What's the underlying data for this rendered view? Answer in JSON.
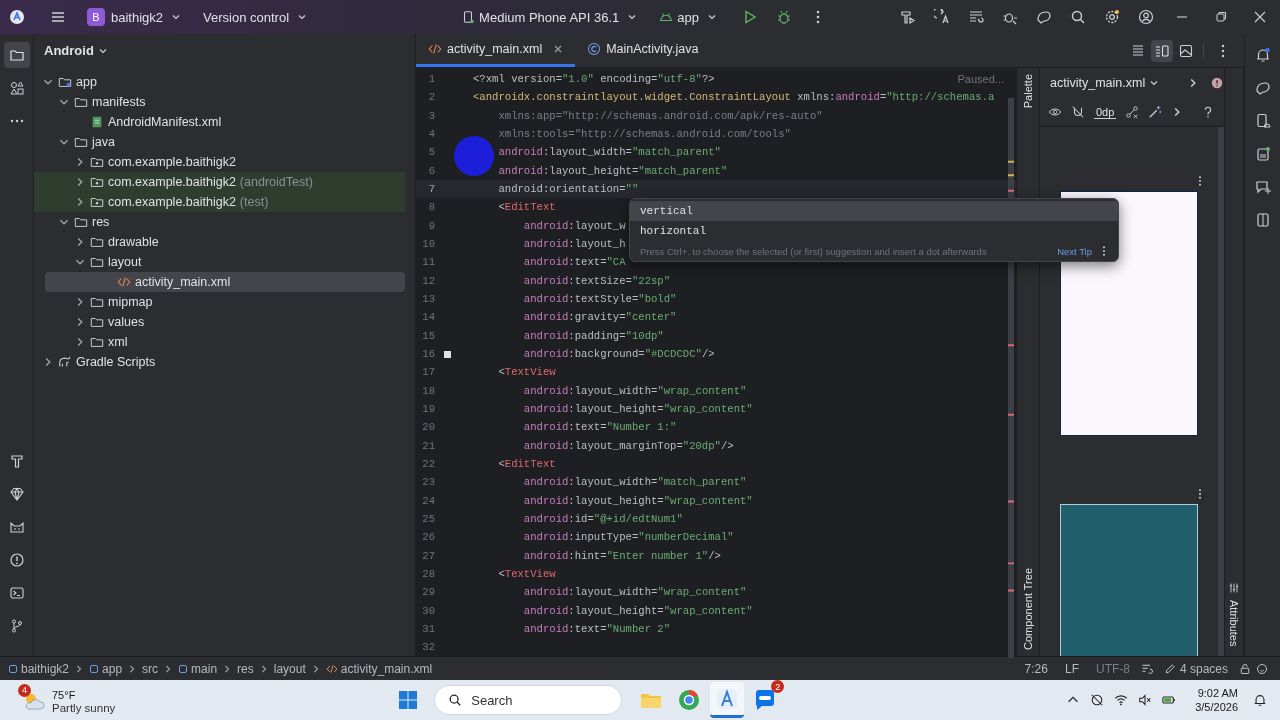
{
  "title_bar": {
    "project_initial": "B",
    "project": "baithigk2",
    "vcs": "Version control",
    "device": "Medium Phone API 36.1",
    "run_config": "app"
  },
  "project_panel": {
    "view": "Android",
    "tree": [
      {
        "label": "app",
        "kind": "module",
        "expanded": true,
        "selected": false,
        "children": [
          {
            "label": "manifests",
            "kind": "folder",
            "expanded": true,
            "selected": false,
            "children": [
              {
                "label": "AndroidManifest.xml",
                "kind": "manifest",
                "selected": false
              }
            ]
          },
          {
            "label": "java",
            "kind": "folder",
            "expanded": true,
            "selected": false,
            "children": [
              {
                "label": "com.example.baithigk2",
                "kind": "package",
                "expanded": false,
                "selected": false
              },
              {
                "label": "com.example.baithigk2",
                "note": "(androidTest)",
                "kind": "test-package",
                "expanded": false,
                "selected": false
              },
              {
                "label": "com.example.baithigk2",
                "note": "(test)",
                "kind": "test-package",
                "expanded": false,
                "selected": false
              }
            ]
          },
          {
            "label": "res",
            "kind": "folder",
            "expanded": true,
            "selected": false,
            "children": [
              {
                "label": "drawable",
                "kind": "folder",
                "expanded": false,
                "selected": false
              },
              {
                "label": "layout",
                "kind": "folder",
                "expanded": true,
                "selected": false,
                "children": [
                  {
                    "label": "activity_main.xml",
                    "kind": "xml",
                    "selected": true
                  }
                ]
              },
              {
                "label": "mipmap",
                "kind": "folder",
                "expanded": false,
                "selected": false
              },
              {
                "label": "values",
                "kind": "folder",
                "expanded": false,
                "selected": false
              },
              {
                "label": "xml",
                "kind": "folder",
                "expanded": false,
                "selected": false
              }
            ]
          }
        ]
      },
      {
        "label": "Gradle Scripts",
        "kind": "scripts",
        "expanded": false,
        "selected": false
      }
    ]
  },
  "editor_tabs": [
    {
      "label": "activity_main.xml",
      "kind": "xml",
      "selected": true,
      "closable": true
    },
    {
      "label": "MainActivity.java",
      "kind": "java",
      "selected": false,
      "closable": false
    }
  ],
  "editor": {
    "status": "Paused...",
    "lines": [
      {
        "number": "1",
        "current": false,
        "bookmark": false,
        "tokens": [
          {
            "kind": "plain",
            "text": "<?xml version="
          },
          {
            "kind": "string",
            "text": "\"1.0\""
          },
          {
            "kind": "plain",
            "text": " encoding="
          },
          {
            "kind": "string",
            "text": "\"utf-8\""
          },
          {
            "kind": "plain",
            "text": "?>"
          }
        ]
      },
      {
        "number": "2",
        "current": false,
        "bookmark": false,
        "tokens": [
          {
            "kind": "tag",
            "text": "<androidx.constraintlayout.widget.ConstraintLayout"
          },
          {
            "kind": "plain",
            "text": " xmlns:"
          },
          {
            "kind": "ns",
            "text": "android"
          },
          {
            "kind": "plain",
            "text": "="
          },
          {
            "kind": "string",
            "text": "\"http://schemas.a"
          }
        ]
      },
      {
        "number": "3",
        "current": false,
        "bookmark": false,
        "tokens": [
          {
            "kind": "dim",
            "text": "    xmlns:app=\"http://schemas.android.com/apk/res-auto\""
          }
        ]
      },
      {
        "number": "4",
        "current": false,
        "bookmark": false,
        "tokens": [
          {
            "kind": "dim",
            "text": "    xmlns:tools=\"http://schemas.android.com/tools\""
          }
        ]
      },
      {
        "number": "5",
        "current": false,
        "bookmark": false,
        "tokens": [
          {
            "kind": "ns",
            "text": "    android"
          },
          {
            "kind": "plain",
            "text": ":layout_width="
          },
          {
            "kind": "string",
            "text": "\"match_parent\""
          }
        ]
      },
      {
        "number": "6",
        "current": false,
        "bookmark": false,
        "tokens": [
          {
            "kind": "ns",
            "text": "    android"
          },
          {
            "kind": "plain",
            "text": ":layout_height="
          },
          {
            "kind": "string",
            "text": "\"match_parent\""
          }
        ]
      },
      {
        "number": "7",
        "current": true,
        "bookmark": false,
        "tokens": [
          {
            "kind": "plain",
            "text": "    android:orientation="
          },
          {
            "kind": "string",
            "text": "\"\""
          }
        ]
      },
      {
        "number": "8",
        "current": false,
        "bookmark": false,
        "tokens": [
          {
            "kind": "plain",
            "text": "    <"
          },
          {
            "kind": "error-tag",
            "text": "EditText"
          }
        ]
      },
      {
        "number": "9",
        "current": false,
        "bookmark": false,
        "tokens": [
          {
            "kind": "ns",
            "text": "        android"
          },
          {
            "kind": "plain",
            "text": ":layout_w"
          }
        ]
      },
      {
        "number": "10",
        "current": false,
        "bookmark": false,
        "tokens": [
          {
            "kind": "ns",
            "text": "        android"
          },
          {
            "kind": "plain",
            "text": ":layout_h"
          }
        ]
      },
      {
        "number": "11",
        "current": false,
        "bookmark": false,
        "tokens": [
          {
            "kind": "ns",
            "text": "        android"
          },
          {
            "kind": "plain",
            "text": ":text="
          },
          {
            "kind": "string",
            "text": "\"CA"
          }
        ]
      },
      {
        "number": "12",
        "current": false,
        "bookmark": false,
        "tokens": [
          {
            "kind": "ns",
            "text": "        android"
          },
          {
            "kind": "plain",
            "text": ":textSize="
          },
          {
            "kind": "string",
            "text": "\"22sp\""
          }
        ]
      },
      {
        "number": "13",
        "current": false,
        "bookmark": false,
        "tokens": [
          {
            "kind": "ns",
            "text": "        android"
          },
          {
            "kind": "plain",
            "text": ":textStyle="
          },
          {
            "kind": "string",
            "text": "\"bold\""
          }
        ]
      },
      {
        "number": "14",
        "current": false,
        "bookmark": false,
        "tokens": [
          {
            "kind": "ns",
            "text": "        android"
          },
          {
            "kind": "plain",
            "text": ":gravity="
          },
          {
            "kind": "string",
            "text": "\"center\""
          }
        ]
      },
      {
        "number": "15",
        "current": false,
        "bookmark": false,
        "tokens": [
          {
            "kind": "ns",
            "text": "        android"
          },
          {
            "kind": "plain",
            "text": ":padding="
          },
          {
            "kind": "string",
            "text": "\"10dp\""
          }
        ]
      },
      {
        "number": "16",
        "current": false,
        "bookmark": true,
        "tokens": [
          {
            "kind": "ns",
            "text": "        android"
          },
          {
            "kind": "plain",
            "text": ":background="
          },
          {
            "kind": "string",
            "text": "\"#DCDCDC\""
          },
          {
            "kind": "plain",
            "text": "/>"
          }
        ]
      },
      {
        "number": "17",
        "current": false,
        "bookmark": false,
        "tokens": [
          {
            "kind": "plain",
            "text": "    <"
          },
          {
            "kind": "error-tag",
            "text": "TextView"
          }
        ]
      },
      {
        "number": "18",
        "current": false,
        "bookmark": false,
        "tokens": [
          {
            "kind": "ns",
            "text": "        android"
          },
          {
            "kind": "plain",
            "text": ":layout_width="
          },
          {
            "kind": "string",
            "text": "\"wrap_content\""
          }
        ]
      },
      {
        "number": "19",
        "current": false,
        "bookmark": false,
        "tokens": [
          {
            "kind": "ns",
            "text": "        android"
          },
          {
            "kind": "plain",
            "text": ":layout_height="
          },
          {
            "kind": "string",
            "text": "\"wrap_content\""
          }
        ]
      },
      {
        "number": "20",
        "current": false,
        "bookmark": false,
        "tokens": [
          {
            "kind": "ns",
            "text": "        android"
          },
          {
            "kind": "plain",
            "text": ":text="
          },
          {
            "kind": "string",
            "text": "\"Number 1:\""
          }
        ]
      },
      {
        "number": "21",
        "current": false,
        "bookmark": false,
        "tokens": [
          {
            "kind": "ns",
            "text": "        android"
          },
          {
            "kind": "plain",
            "text": ":layout_marginTop="
          },
          {
            "kind": "string",
            "text": "\"20dp\""
          },
          {
            "kind": "plain",
            "text": "/>"
          }
        ]
      },
      {
        "number": "22",
        "current": false,
        "bookmark": false,
        "tokens": [
          {
            "kind": "plain",
            "text": "    <"
          },
          {
            "kind": "error-tag",
            "text": "EditText"
          }
        ]
      },
      {
        "number": "23",
        "current": false,
        "bookmark": false,
        "tokens": [
          {
            "kind": "ns",
            "text": "        android"
          },
          {
            "kind": "plain",
            "text": ":layout_width="
          },
          {
            "kind": "string",
            "text": "\"match_parent\""
          }
        ]
      },
      {
        "number": "24",
        "current": false,
        "bookmark": false,
        "tokens": [
          {
            "kind": "ns",
            "text": "        android"
          },
          {
            "kind": "plain",
            "text": ":layout_height="
          },
          {
            "kind": "string",
            "text": "\"wrap_content\""
          }
        ]
      },
      {
        "number": "25",
        "current": false,
        "bookmark": false,
        "tokens": [
          {
            "kind": "ns",
            "text": "        android"
          },
          {
            "kind": "plain",
            "text": ":id="
          },
          {
            "kind": "string",
            "text": "\"@+id/edtNum1\""
          }
        ]
      },
      {
        "number": "26",
        "current": false,
        "bookmark": false,
        "tokens": [
          {
            "kind": "ns",
            "text": "        android"
          },
          {
            "kind": "plain",
            "text": ":inputType="
          },
          {
            "kind": "string",
            "text": "\"numberDecimal\""
          }
        ]
      },
      {
        "number": "27",
        "current": false,
        "bookmark": false,
        "tokens": [
          {
            "kind": "ns",
            "text": "        android"
          },
          {
            "kind": "plain",
            "text": ":hint="
          },
          {
            "kind": "string",
            "text": "\"Enter number 1\""
          },
          {
            "kind": "plain",
            "text": "/>"
          }
        ]
      },
      {
        "number": "28",
        "current": false,
        "bookmark": false,
        "tokens": [
          {
            "kind": "plain",
            "text": "    <"
          },
          {
            "kind": "error-tag",
            "text": "TextView"
          }
        ]
      },
      {
        "number": "29",
        "current": false,
        "bookmark": false,
        "tokens": [
          {
            "kind": "ns",
            "text": "        android"
          },
          {
            "kind": "plain",
            "text": ":layout_width="
          },
          {
            "kind": "string",
            "text": "\"wrap_content\""
          }
        ]
      },
      {
        "number": "30",
        "current": false,
        "bookmark": false,
        "tokens": [
          {
            "kind": "ns",
            "text": "        android"
          },
          {
            "kind": "plain",
            "text": ":layout_height="
          },
          {
            "kind": "string",
            "text": "\"wrap_content\""
          }
        ]
      },
      {
        "number": "31",
        "current": false,
        "bookmark": false,
        "tokens": [
          {
            "kind": "ns",
            "text": "        android"
          },
          {
            "kind": "plain",
            "text": ":text="
          },
          {
            "kind": "string",
            "text": "\"Number 2\""
          }
        ]
      },
      {
        "number": "32",
        "current": false,
        "bookmark": false
      }
    ]
  },
  "completion_popup": {
    "items": [
      {
        "label": "vertical",
        "selected": true
      },
      {
        "label": "horizontal",
        "selected": false
      }
    ],
    "hint": "Press Ctrl+. to choose the selected (or first) suggestion and insert a dot afterwards",
    "link": "Next Tip"
  },
  "side_tabs": {
    "palette": "Palette",
    "component_tree": "Component Tree",
    "attributes": "Attributes"
  },
  "design_panel": {
    "file": "activity_main.xml",
    "margin": "0dp"
  },
  "breadcrumb": [
    {
      "label": "baithigk2",
      "kind": "module"
    },
    {
      "label": "app",
      "kind": "module"
    },
    {
      "label": "src",
      "kind": "folder"
    },
    {
      "label": "main",
      "kind": "module"
    },
    {
      "label": "res",
      "kind": "folder"
    },
    {
      "label": "layout",
      "kind": "folder"
    },
    {
      "label": "activity_main.xml",
      "kind": "xml"
    }
  ],
  "status_bar": {
    "position": "7:26",
    "line_separator": "LF",
    "encoding": "UTF-8",
    "indent": "4 spaces"
  },
  "taskbar": {
    "weather_badge": "4",
    "temperature": "75°F",
    "weather": "Partly sunny",
    "search_placeholder": "Search",
    "apps": [
      {
        "kind": "explorer",
        "active": false
      },
      {
        "kind": "browser",
        "active": false
      },
      {
        "kind": "studio",
        "active": true
      },
      {
        "kind": "chat",
        "active": false,
        "badge": "2"
      }
    ],
    "time": "9:02 AM",
    "date": "3/5/2026"
  }
}
